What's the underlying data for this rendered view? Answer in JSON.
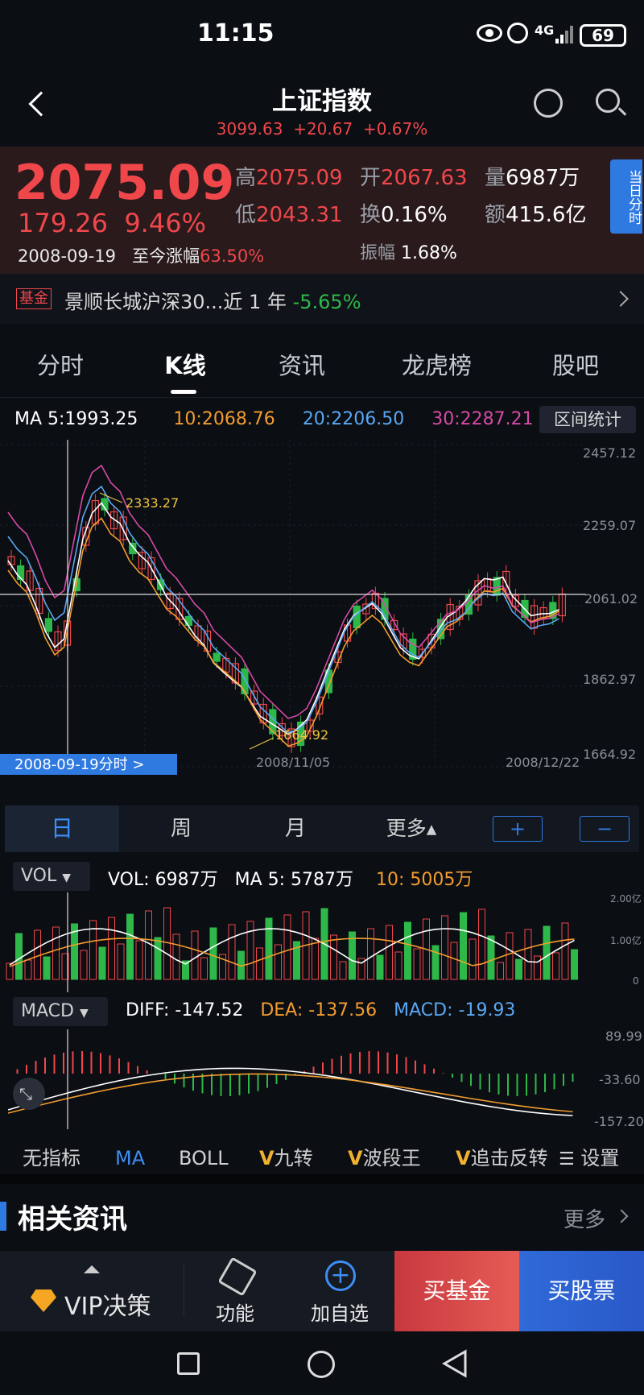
{
  "status": {
    "time": "11:15",
    "network": "4G",
    "battery": "69"
  },
  "header": {
    "title": "上证指数",
    "sub_price": "3099.63",
    "sub_change": "+20.67",
    "sub_pct": "+0.67%"
  },
  "quote": {
    "price": "2075.09",
    "change": "179.26",
    "pct": "9.46%",
    "date": "2008-09-19",
    "since_label": "至今涨幅",
    "since_value": "63.50%",
    "high_label": "高",
    "high": "2075.09",
    "open_label": "开",
    "open": "2067.63",
    "vol_label": "量",
    "vol": "6987万",
    "low_label": "低",
    "low": "2043.31",
    "turn_label": "换",
    "turn": "0.16%",
    "amt_label": "额",
    "amt": "415.6亿",
    "amp_label": "振幅",
    "amp": "1.68%",
    "side_tab": "当日分时"
  },
  "fund": {
    "badge": "基金",
    "name": "景顺长城沪深30...近 1 年",
    "ret": "-5.65%"
  },
  "tabs": [
    "分时",
    "K线",
    "资讯",
    "龙虎榜",
    "股吧"
  ],
  "ma": {
    "ma5": "MA 5:1993.25",
    "ma10": "10:2068.76",
    "ma20": "20:2206.50",
    "ma30": "30:2287.21",
    "stat_btn": "区间统计"
  },
  "kchart": {
    "y_ticks": [
      "2457.12",
      "2259.07",
      "2061.02",
      "1862.97",
      "1664.92"
    ],
    "hi_label": "2333.27",
    "lo_label": "1664.92",
    "date_mid": "2008/11/05",
    "date_end": "2008/12/22",
    "crosshair_tag": "2008-09-19分时 >"
  },
  "period": {
    "day": "日",
    "week": "周",
    "month": "月",
    "more": "更多▴",
    "plus": "+",
    "minus": "−"
  },
  "vol": {
    "selector": "VOL",
    "vol": "VOL: 6987万",
    "ma5": "MA 5: 5787万",
    "ma10": "10: 5005万",
    "ticks": [
      "2.00亿",
      "1.00亿",
      "0"
    ]
  },
  "macd": {
    "selector": "MACD",
    "diff": "DIFF: -147.52",
    "dea": "DEA: -137.56",
    "macd": "MACD: -19.93",
    "ticks": [
      "89.99",
      "-33.60",
      "-157.20"
    ]
  },
  "indicators": [
    "无指标",
    "MA",
    "BOLL",
    "九转",
    "波段王",
    "追击反转"
  ],
  "settings": "设置",
  "news": {
    "title": "相关资讯",
    "more": "更多"
  },
  "bottom": {
    "vip": "VIP决策",
    "func": "功能",
    "add": "加自选",
    "buy_fund": "买基金",
    "buy_stock": "买股票"
  },
  "colors": {
    "up": "#f0474b",
    "down": "#2fb84a",
    "ma5": "#ffffff",
    "ma10": "#f39c2f",
    "ma20": "#5aa7f2",
    "ma30": "#d64aa5"
  }
}
